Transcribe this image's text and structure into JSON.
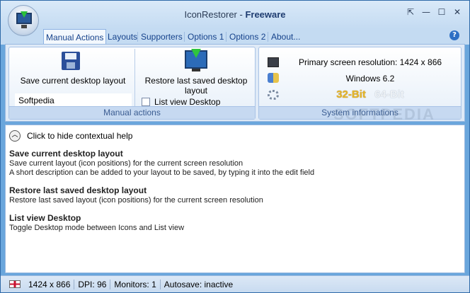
{
  "window": {
    "title_main": "IconRestorer",
    "title_sep": " - ",
    "title_edition": "Freeware",
    "buttons": {
      "restore_glyph": "⇱",
      "minimize_glyph": "—",
      "maximize_glyph": "☐",
      "close_glyph": "✕"
    }
  },
  "tabs": [
    {
      "label": "Manual Actions",
      "active": true
    },
    {
      "label": "Layouts"
    },
    {
      "label": "Supporters"
    },
    {
      "label": "Options 1"
    },
    {
      "label": "Options 2"
    },
    {
      "label": "About..."
    }
  ],
  "help_glyph": "?",
  "ribbon": {
    "manual": {
      "group_label": "Manual actions",
      "save_label": "Save current desktop layout",
      "description_value": "Softpedia",
      "restore_label": "Restore last saved desktop layout",
      "list_view_label": "List view Desktop",
      "list_view_checked": false
    },
    "system": {
      "group_label": "System informations",
      "resolution": "Primary screen resolution: 1424 x 866",
      "os": "Windows 6.2",
      "bit32": "32-Bit",
      "bit64": "64-Bit"
    }
  },
  "content": {
    "toggle_glyph": "︿",
    "toggle_label": "Click to hide contextual help",
    "sections": [
      {
        "heading": "Save current desktop layout",
        "lines": [
          "Save current layout (icon positions) for the current screen resolution",
          "A short description can be added to your layout to be saved, by typing it into the edit field"
        ]
      },
      {
        "heading": "Restore last saved desktop layout",
        "lines": [
          "Restore last saved layout (icon positions) for the current screen resolution"
        ]
      },
      {
        "heading": "List view Desktop",
        "lines": [
          "Toggle Desktop mode between Icons and List view"
        ]
      }
    ],
    "watermark": "SOFTPEDIA"
  },
  "status": {
    "resolution": "1424 x 866",
    "dpi": "DPI: 96",
    "monitors": "Monitors: 1",
    "autosave": "Autosave: inactive"
  }
}
